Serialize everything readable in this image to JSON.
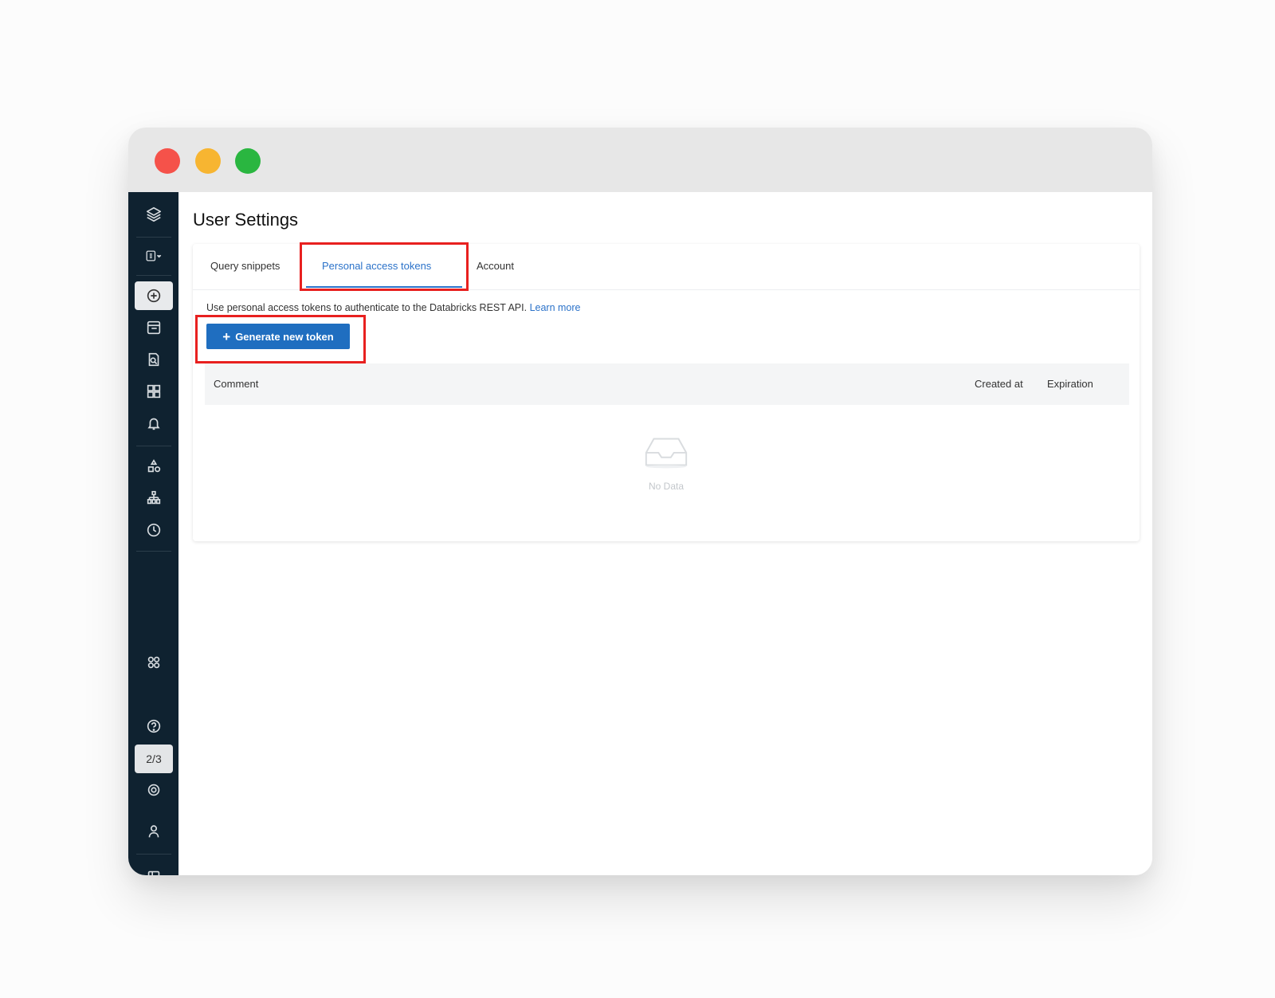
{
  "window": {
    "traffic_lights": [
      "close",
      "minimize",
      "maximize"
    ]
  },
  "sidebar": {
    "items": [
      {
        "icon": "databricks-logo-icon"
      },
      {
        "icon": "sql-persona-switcher-icon"
      },
      {
        "icon": "create-icon",
        "active": true
      },
      {
        "icon": "sql-editor-icon"
      },
      {
        "icon": "queries-icon"
      },
      {
        "icon": "dashboards-icon"
      },
      {
        "icon": "alerts-icon"
      },
      {
        "icon": "data-icon"
      },
      {
        "icon": "sql-warehouses-icon"
      },
      {
        "icon": "query-history-icon"
      },
      {
        "icon": "partner-connect-icon"
      },
      {
        "icon": "help-icon"
      },
      {
        "icon": "settings-icon"
      },
      {
        "icon": "user-icon"
      },
      {
        "icon": "collapse-sidebar-icon"
      }
    ],
    "page_count": "2/3"
  },
  "page": {
    "title": "User Settings",
    "tabs": [
      {
        "label": "Query snippets"
      },
      {
        "label": "Personal access tokens",
        "active": true
      },
      {
        "label": "Account"
      }
    ],
    "description": "Use personal access tokens to authenticate to the Databricks REST API.",
    "learn_more": "Learn more",
    "generate_button": "Generate new token",
    "table": {
      "columns": [
        "Comment",
        "Created at",
        "Expiration"
      ],
      "rows": []
    },
    "empty_text": "No Data"
  },
  "colors": {
    "accent": "#2b72c9",
    "button": "#1f6ec0",
    "sidebar": "#0f2230",
    "highlight": "#e8201f"
  }
}
